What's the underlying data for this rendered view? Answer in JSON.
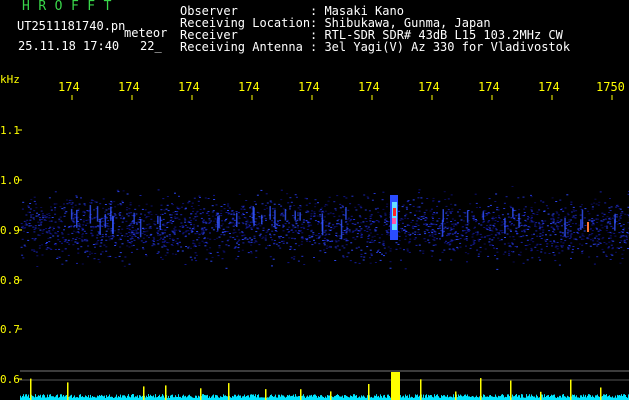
{
  "header": {
    "title": "HROFFT",
    "file_name": "UT2511181740.pn",
    "meteor_tag": "meteor",
    "date_time": "25.11.18 17:40",
    "date_extra": "22_"
  },
  "info": [
    {
      "label": "Observer",
      "value": ": Masaki Kano"
    },
    {
      "label": "Receiving Location",
      "value": ": Shibukawa, Gunma, Japan"
    },
    {
      "label": "Receiver",
      "value": ": RTL-SDR SDR# 43dB L15 103.2MHz CW"
    },
    {
      "label": "Receiving Antenna",
      "value": ": 3el Yagi(V) Az 330 for Vladivostok"
    }
  ],
  "axis": {
    "y_unit": "kHz",
    "x_ticks": [
      "174",
      "174",
      "174",
      "174",
      "174",
      "174",
      "174",
      "174",
      "174",
      "1750"
    ],
    "y_ticks": [
      "1.1",
      "1.0",
      "0.9",
      "0.8",
      "0.7",
      "0.6"
    ]
  },
  "colors": {
    "header_title": "#39d64a",
    "text": "#ffffff",
    "ticks": "#ffff00",
    "spectrum_low": "#0a0a66",
    "spectrum_mid": "#2244ff",
    "spectrum_high": "#ff2222",
    "baseline": "#00e5ff"
  }
}
